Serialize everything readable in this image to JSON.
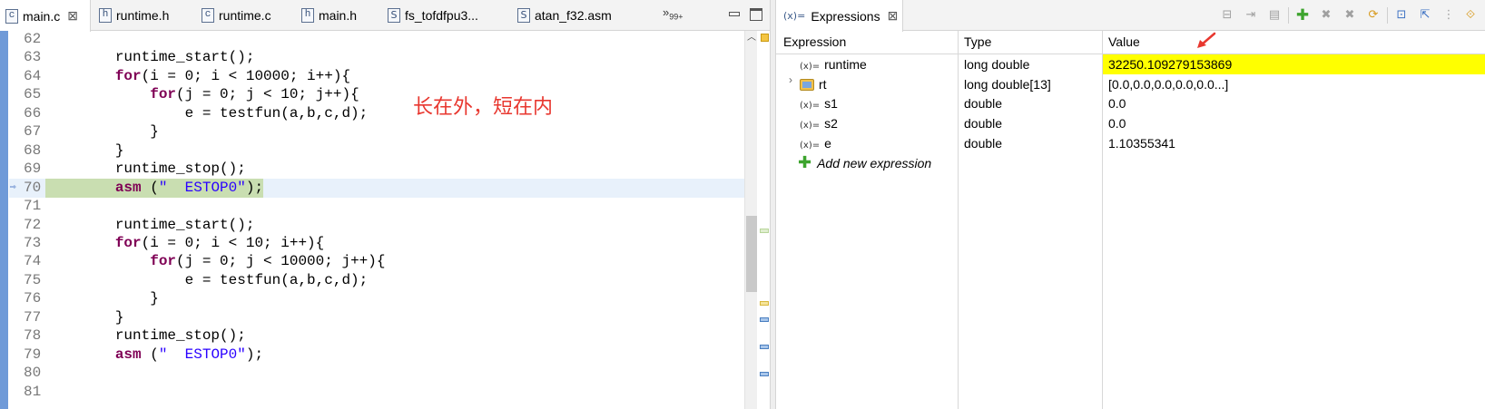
{
  "editor": {
    "tabs": [
      {
        "label": "main.c",
        "icon": "c-file-icon",
        "glyph": "c",
        "active": true
      },
      {
        "label": "runtime.h",
        "icon": "h-file-icon",
        "glyph": "h",
        "active": false
      },
      {
        "label": "runtime.c",
        "icon": "c-file-icon",
        "glyph": "c",
        "active": false
      },
      {
        "label": "main.h",
        "icon": "h-file-icon",
        "glyph": "h",
        "active": false
      },
      {
        "label": "fs_tofdfpu3...",
        "icon": "asm-file-icon",
        "glyph": "S",
        "active": false
      },
      {
        "label": "atan_f32.asm",
        "icon": "asm-file-icon",
        "glyph": "S",
        "active": false
      }
    ],
    "close_glyph": "⊠",
    "more_tabs": "»",
    "more_tabs_count": "99+",
    "lines": [
      {
        "n": "62",
        "html": ""
      },
      {
        "n": "63",
        "html": "        runtime_start();"
      },
      {
        "n": "64",
        "html": "        <span class=\"kw\">for</span>(i = 0; i &lt; 10000; i++){"
      },
      {
        "n": "65",
        "html": "            <span class=\"kw\">for</span>(j = 0; j &lt; 10; j++){"
      },
      {
        "n": "66",
        "html": "                e = testfun(a,b,c,d);"
      },
      {
        "n": "67",
        "html": "            }"
      },
      {
        "n": "68",
        "html": "        }"
      },
      {
        "n": "69",
        "html": "        runtime_stop();"
      },
      {
        "n": "70",
        "html": "        <span class=\"kw\">asm</span> (<span class=\"str\">\"  ESTOP0\"</span>);",
        "current": true
      },
      {
        "n": "71",
        "html": ""
      },
      {
        "n": "72",
        "html": "        runtime_start();"
      },
      {
        "n": "73",
        "html": "        <span class=\"kw\">for</span>(i = 0; i &lt; 10; i++){"
      },
      {
        "n": "74",
        "html": "            <span class=\"kw\">for</span>(j = 0; j &lt; 10000; j++){"
      },
      {
        "n": "75",
        "html": "                e = testfun(a,b,c,d);"
      },
      {
        "n": "76",
        "html": "            }"
      },
      {
        "n": "77",
        "html": "        }"
      },
      {
        "n": "78",
        "html": "        runtime_stop();"
      },
      {
        "n": "79",
        "html": "        <span class=\"kw\">asm</span> (<span class=\"str\">\"  ESTOP0\"</span>);"
      },
      {
        "n": "80",
        "html": ""
      },
      {
        "n": "81",
        "html": ""
      }
    ],
    "annotation": "长在外，短在内"
  },
  "expressions": {
    "tab_label": "Expressions",
    "tab_icon_glyph": "(x)=",
    "close_glyph": "⊠",
    "columns": {
      "expression": "Expression",
      "type": "Type",
      "value": "Value"
    },
    "rows": [
      {
        "name": "runtime",
        "type": "long double",
        "value": "32250.109279153869",
        "kind": "var",
        "highlight": true
      },
      {
        "name": "rt",
        "type": "long double[13]",
        "value": "[0.0,0.0,0.0,0.0,0.0...]",
        "kind": "array",
        "expandable": true
      },
      {
        "name": "s1",
        "type": "double",
        "value": "0.0",
        "kind": "var"
      },
      {
        "name": "s2",
        "type": "double",
        "value": "0.0",
        "kind": "var"
      },
      {
        "name": "e",
        "type": "double",
        "value": "1.10355341",
        "kind": "var"
      }
    ],
    "add_new": "Add new expression",
    "var_icon_glyph": "(x)=",
    "highlight_color": "#ffff00"
  },
  "colors": {
    "keyword": "#7f0055",
    "string": "#2a00ff",
    "annotation": "#e8372f",
    "current_line": "#c9deb1",
    "gutter": "#6f9ad8"
  }
}
